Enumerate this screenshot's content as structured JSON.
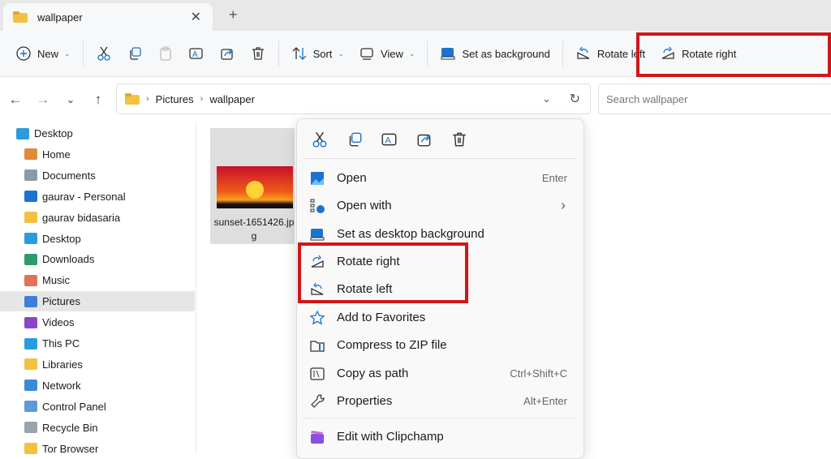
{
  "tab": {
    "title": "wallpaper",
    "close": "✕",
    "new": "+"
  },
  "toolbar": {
    "new": "New",
    "sort": "Sort",
    "view": "View",
    "set_background": "Set as background",
    "rotate_left": "Rotate left",
    "rotate_right": "Rotate right"
  },
  "nav": {
    "back": "←",
    "forward": "→",
    "recent": "⌄",
    "up": "↑",
    "path": [
      "Pictures",
      "wallpaper"
    ],
    "search_placeholder": "Search wallpaper"
  },
  "sidebar": {
    "items": [
      {
        "label": "Desktop",
        "color": "#2b9be0"
      },
      {
        "label": "Home",
        "color": "#e08a3c"
      },
      {
        "label": "Documents",
        "color": "#8d99a6"
      },
      {
        "label": "gaurav - Personal",
        "color": "#1a73d1"
      },
      {
        "label": "gaurav bidasaria",
        "color": "#f3c142"
      },
      {
        "label": "Desktop",
        "color": "#2b9be0"
      },
      {
        "label": "Downloads",
        "color": "#2a9d6c"
      },
      {
        "label": "Music",
        "color": "#e0735a"
      },
      {
        "label": "Pictures",
        "color": "#3d7fd6"
      },
      {
        "label": "Videos",
        "color": "#8a45c9"
      },
      {
        "label": "This PC",
        "color": "#2b9be0"
      },
      {
        "label": "Libraries",
        "color": "#f3c142"
      },
      {
        "label": "Network",
        "color": "#3a8ad6"
      },
      {
        "label": "Control Panel",
        "color": "#5c9bd6"
      },
      {
        "label": "Recycle Bin",
        "color": "#9aa4ad"
      },
      {
        "label": "Tor Browser",
        "color": "#f3c142"
      }
    ]
  },
  "file": {
    "name": "sunset-1651426.jpg"
  },
  "menu": {
    "items": [
      {
        "label": "Open",
        "shortcut": "Enter"
      },
      {
        "label": "Open with",
        "shortcut": "›"
      },
      {
        "label": "Set as desktop background",
        "shortcut": ""
      },
      {
        "label": "Rotate right",
        "shortcut": ""
      },
      {
        "label": "Rotate left",
        "shortcut": ""
      },
      {
        "label": "Add to Favorites",
        "shortcut": ""
      },
      {
        "label": "Compress to ZIP file",
        "shortcut": ""
      },
      {
        "label": "Copy as path",
        "shortcut": "Ctrl+Shift+C"
      },
      {
        "label": "Properties",
        "shortcut": "Alt+Enter"
      },
      {
        "label": "Edit with Clipchamp",
        "shortcut": ""
      }
    ]
  },
  "colors": {
    "highlight": "#d0161a",
    "accent": "#1a73d1"
  }
}
